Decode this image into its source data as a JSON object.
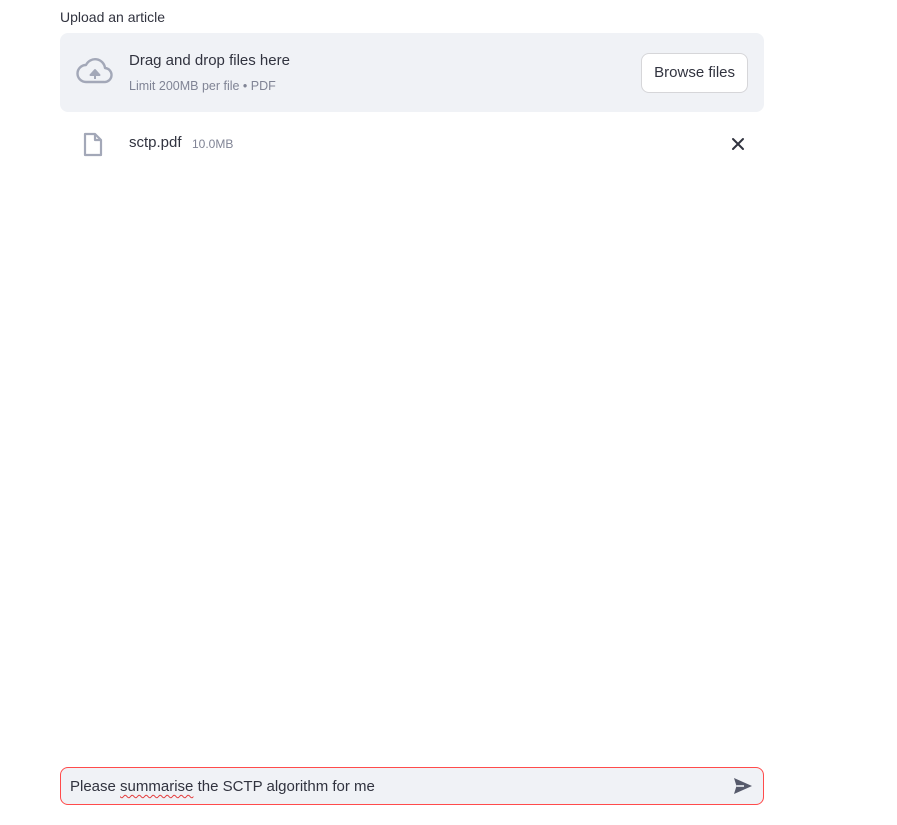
{
  "uploader": {
    "label": "Upload an article",
    "drop_title": "Drag and drop files here",
    "drop_limit": "Limit 200MB per file • PDF",
    "browse_label": "Browse files",
    "cloud_icon": "cloud-upload-icon"
  },
  "uploaded_file": {
    "name": "sctp.pdf",
    "size": "10.0MB",
    "file_icon": "file-icon",
    "remove_icon": "close-icon"
  },
  "chat": {
    "value_pre": "Please ",
    "value_misspelled": "summarise",
    "value_post": " the SCTP algorithm for me",
    "send_icon": "send-icon"
  },
  "colors": {
    "text": "#31333F",
    "muted": "#808495",
    "dropzone_bg": "#F0F2F6",
    "focus_border": "#FF4B4B",
    "icon": "#A3A8B8"
  }
}
